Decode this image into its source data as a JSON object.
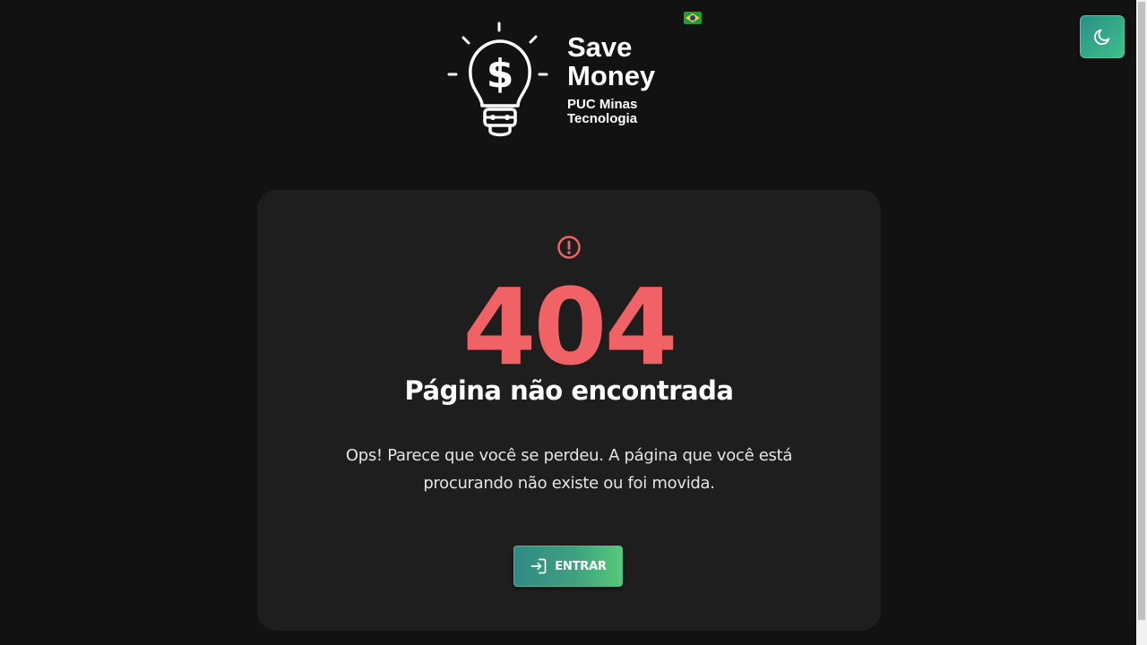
{
  "brand": {
    "title": "Save Money",
    "subtitle": "PUC Minas Tecnologia",
    "logo_icon": "lightbulb-dollar-icon"
  },
  "language": {
    "flag_icon": "brazil-flag-icon"
  },
  "theme_toggle": {
    "icon": "moon-icon"
  },
  "error_card": {
    "icon": "alert-circle-icon",
    "code": "404",
    "title": "Página não encontrada",
    "message": "Ops! Parece que você se perdeu. A página que você está procurando não existe ou foi movida.",
    "button_label": "ENTRAR",
    "button_icon": "login-icon"
  },
  "colors": {
    "background": "#121212",
    "card": "#1e1e1e",
    "error_accent": "#f06266",
    "button_gradient_start": "#2f8a85",
    "button_gradient_end": "#56c87a"
  }
}
